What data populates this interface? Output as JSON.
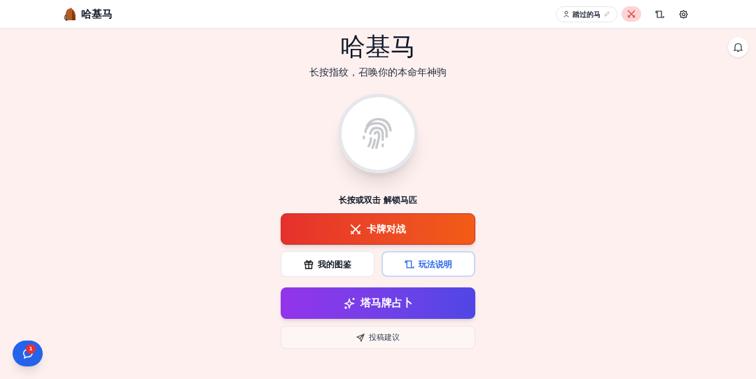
{
  "header": {
    "brand": "哈基马",
    "user_name": "踏过的马"
  },
  "title": "哈基马",
  "subtitle": "长按指纹，召唤你的本命年神驹",
  "hint": "长按或双击 解锁马匹",
  "actions": [
    {
      "kind": "battle",
      "label": "卡牌对战"
    },
    {
      "kind": "collection",
      "label": "我的图鉴"
    },
    {
      "kind": "rules",
      "label": "玩法说明"
    },
    {
      "kind": "tarot",
      "label": "塔马牌占卜"
    },
    {
      "kind": "feedback",
      "label": "投稿建议"
    }
  ],
  "chat": {
    "badge": "1"
  }
}
